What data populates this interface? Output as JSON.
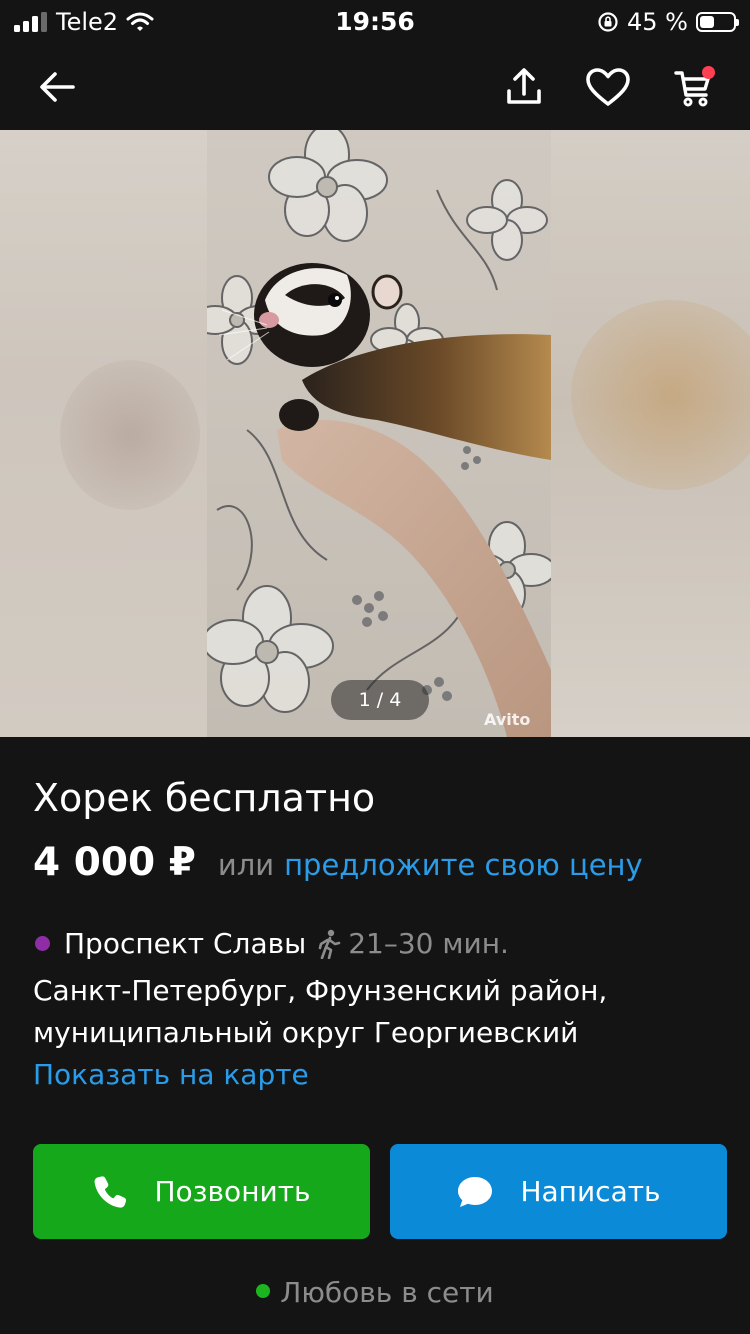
{
  "status_bar": {
    "carrier": "Tele2",
    "time": "19:56",
    "battery": "45 %",
    "battery_level": 0.45
  },
  "nav": {
    "icons": [
      "back-arrow-icon",
      "share-icon",
      "heart-icon",
      "cart-icon"
    ]
  },
  "gallery": {
    "counter": "1 / 4",
    "watermark": "Avito"
  },
  "listing": {
    "title": "Хорек бесплатно",
    "price": "4 000 ₽",
    "price_or": "или",
    "price_offer": "предложите свою цену",
    "metro_station": "Проспект Славы",
    "metro_color": "#8e2da5",
    "walk_time": "21–30 мин.",
    "address": "Санкт-Петербург, Фрунзенский район, муниципальный округ Георгиевский",
    "map_link": "Показать на карте"
  },
  "actions": {
    "call_label": "Позвонить",
    "write_label": "Написать",
    "call_color": "#14a81a",
    "write_color": "#0b8ad8"
  },
  "seller": {
    "status": "Любовь в сети",
    "online_color": "#1db51f"
  }
}
